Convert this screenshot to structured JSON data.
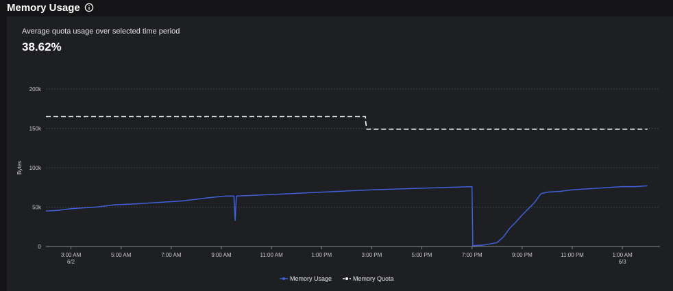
{
  "header": {
    "title": "Memory Usage",
    "info_icon": "info-circle-icon"
  },
  "summary": {
    "subtitle": "Average quota usage over selected time period",
    "value": "38.62%"
  },
  "colors": {
    "usage": "#3f62dc",
    "quota": "#ffffff",
    "grid": "#4a4b50",
    "background": "#1e1f22"
  },
  "chart_data": {
    "type": "line",
    "ylabel": "Bytes",
    "xlabel": "",
    "ylim": [
      0,
      200000
    ],
    "yticks": [
      {
        "value": 0,
        "label": "0"
      },
      {
        "value": 50000,
        "label": "50k"
      },
      {
        "value": 100000,
        "label": "100k"
      },
      {
        "value": 150000,
        "label": "150k"
      },
      {
        "value": 200000,
        "label": "200k"
      }
    ],
    "xlim": [
      "06/02 02:00",
      "06/03 02:30"
    ],
    "xticks": [
      {
        "x": "06/02 03:00",
        "label": "3:00 AM",
        "sublabel": "6/2"
      },
      {
        "x": "06/02 05:00",
        "label": "5:00 AM",
        "sublabel": ""
      },
      {
        "x": "06/02 07:00",
        "label": "7:00 AM",
        "sublabel": ""
      },
      {
        "x": "06/02 09:00",
        "label": "9:00 AM",
        "sublabel": ""
      },
      {
        "x": "06/02 11:00",
        "label": "11:00 AM",
        "sublabel": ""
      },
      {
        "x": "06/02 13:00",
        "label": "1:00 PM",
        "sublabel": ""
      },
      {
        "x": "06/02 15:00",
        "label": "3:00 PM",
        "sublabel": ""
      },
      {
        "x": "06/02 17:00",
        "label": "5:00 PM",
        "sublabel": ""
      },
      {
        "x": "06/02 19:00",
        "label": "7:00 PM",
        "sublabel": ""
      },
      {
        "x": "06/02 21:00",
        "label": "9:00 PM",
        "sublabel": ""
      },
      {
        "x": "06/02 23:00",
        "label": "11:00 PM",
        "sublabel": ""
      },
      {
        "x": "06/03 01:00",
        "label": "1:00 AM",
        "sublabel": "6/3"
      }
    ],
    "grid": true,
    "legend_position": "bottom-center",
    "series": [
      {
        "name": "Memory Usage",
        "style": "solid",
        "points": [
          [
            "06/02 02:00",
            45000
          ],
          [
            "06/02 02:30",
            46000
          ],
          [
            "06/02 03:00",
            48000
          ],
          [
            "06/02 04:00",
            50000
          ],
          [
            "06/02 04:45",
            53000
          ],
          [
            "06/02 05:30",
            54000
          ],
          [
            "06/02 06:30",
            56000
          ],
          [
            "06/02 07:30",
            58000
          ],
          [
            "06/02 08:30",
            62000
          ],
          [
            "06/02 09:10",
            64000
          ],
          [
            "06/02 09:30",
            64000
          ],
          [
            "06/02 09:33",
            33000
          ],
          [
            "06/02 09:36",
            64000
          ],
          [
            "06/02 11:00",
            66000
          ],
          [
            "06/02 13:00",
            69000
          ],
          [
            "06/02 15:00",
            72000
          ],
          [
            "06/02 17:00",
            74000
          ],
          [
            "06/02 19:00",
            76000
          ],
          [
            "06/02 19:02",
            1000
          ],
          [
            "06/02 19:30",
            2000
          ],
          [
            "06/02 20:00",
            5000
          ],
          [
            "06/02 20:15",
            12000
          ],
          [
            "06/02 20:30",
            23000
          ],
          [
            "06/02 20:45",
            31000
          ],
          [
            "06/02 21:00",
            40000
          ],
          [
            "06/02 21:15",
            48000
          ],
          [
            "06/02 21:30",
            56000
          ],
          [
            "06/02 21:45",
            67000
          ],
          [
            "06/02 22:00",
            69000
          ],
          [
            "06/02 22:30",
            70000
          ],
          [
            "06/02 23:00",
            72000
          ],
          [
            "06/03 00:00",
            74000
          ],
          [
            "06/03 00:30",
            75000
          ],
          [
            "06/03 01:00",
            76000
          ],
          [
            "06/03 01:30",
            76000
          ],
          [
            "06/03 02:00",
            77000
          ]
        ]
      },
      {
        "name": "Memory Quota",
        "style": "dashed",
        "points": [
          [
            "06/02 02:00",
            165000
          ],
          [
            "06/02 14:45",
            165000
          ],
          [
            "06/02 14:45",
            160000
          ],
          [
            "06/02 14:48",
            149000
          ],
          [
            "06/03 02:00",
            149000
          ]
        ]
      }
    ]
  }
}
